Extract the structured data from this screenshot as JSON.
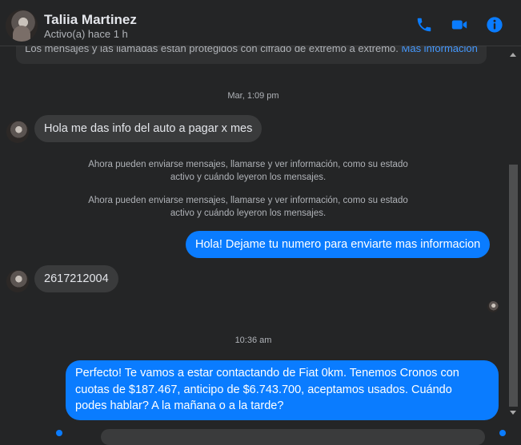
{
  "header": {
    "contact_name": "Taliia Martinez",
    "status": "Activo(a) hace 1 h",
    "icons": [
      "phone-icon",
      "video-camera-icon",
      "info-icon"
    ],
    "accent_color": "#0a7cff"
  },
  "chat": {
    "encryption_notice": "Los mensajes y las llamadas están protegidos con cifrado de extremo a extremo.",
    "encryption_link": "Más información",
    "timestamp_1": "Mar, 1:09 pm",
    "msg_1": "Hola me das info del auto a pagar x mes",
    "system_1_line1": "Ahora pueden enviarse mensajes, llamarse y ver información, como su estado",
    "system_1_line2": "activo y cuándo leyeron los mensajes.",
    "system_2_line1": "Ahora pueden enviarse mensajes, llamarse y ver información, como su estado",
    "system_2_line2": "activo y cuándo leyeron los mensajes.",
    "msg_2": "Hola! Dejame tu numero para enviarte mas informacion",
    "msg_3": "2617212004",
    "timestamp_2": "10:36 am",
    "msg_4_line1": "Perfecto! Te vamos a estar contactando de Fiat 0km. Tenemos Cronos con",
    "msg_4_line2": "cuotas de $187.467, anticipo de $6.743.700, aceptamos usados. Cuándo",
    "msg_4_line3": "podes hablar? A la mañana o a la tarde?"
  }
}
